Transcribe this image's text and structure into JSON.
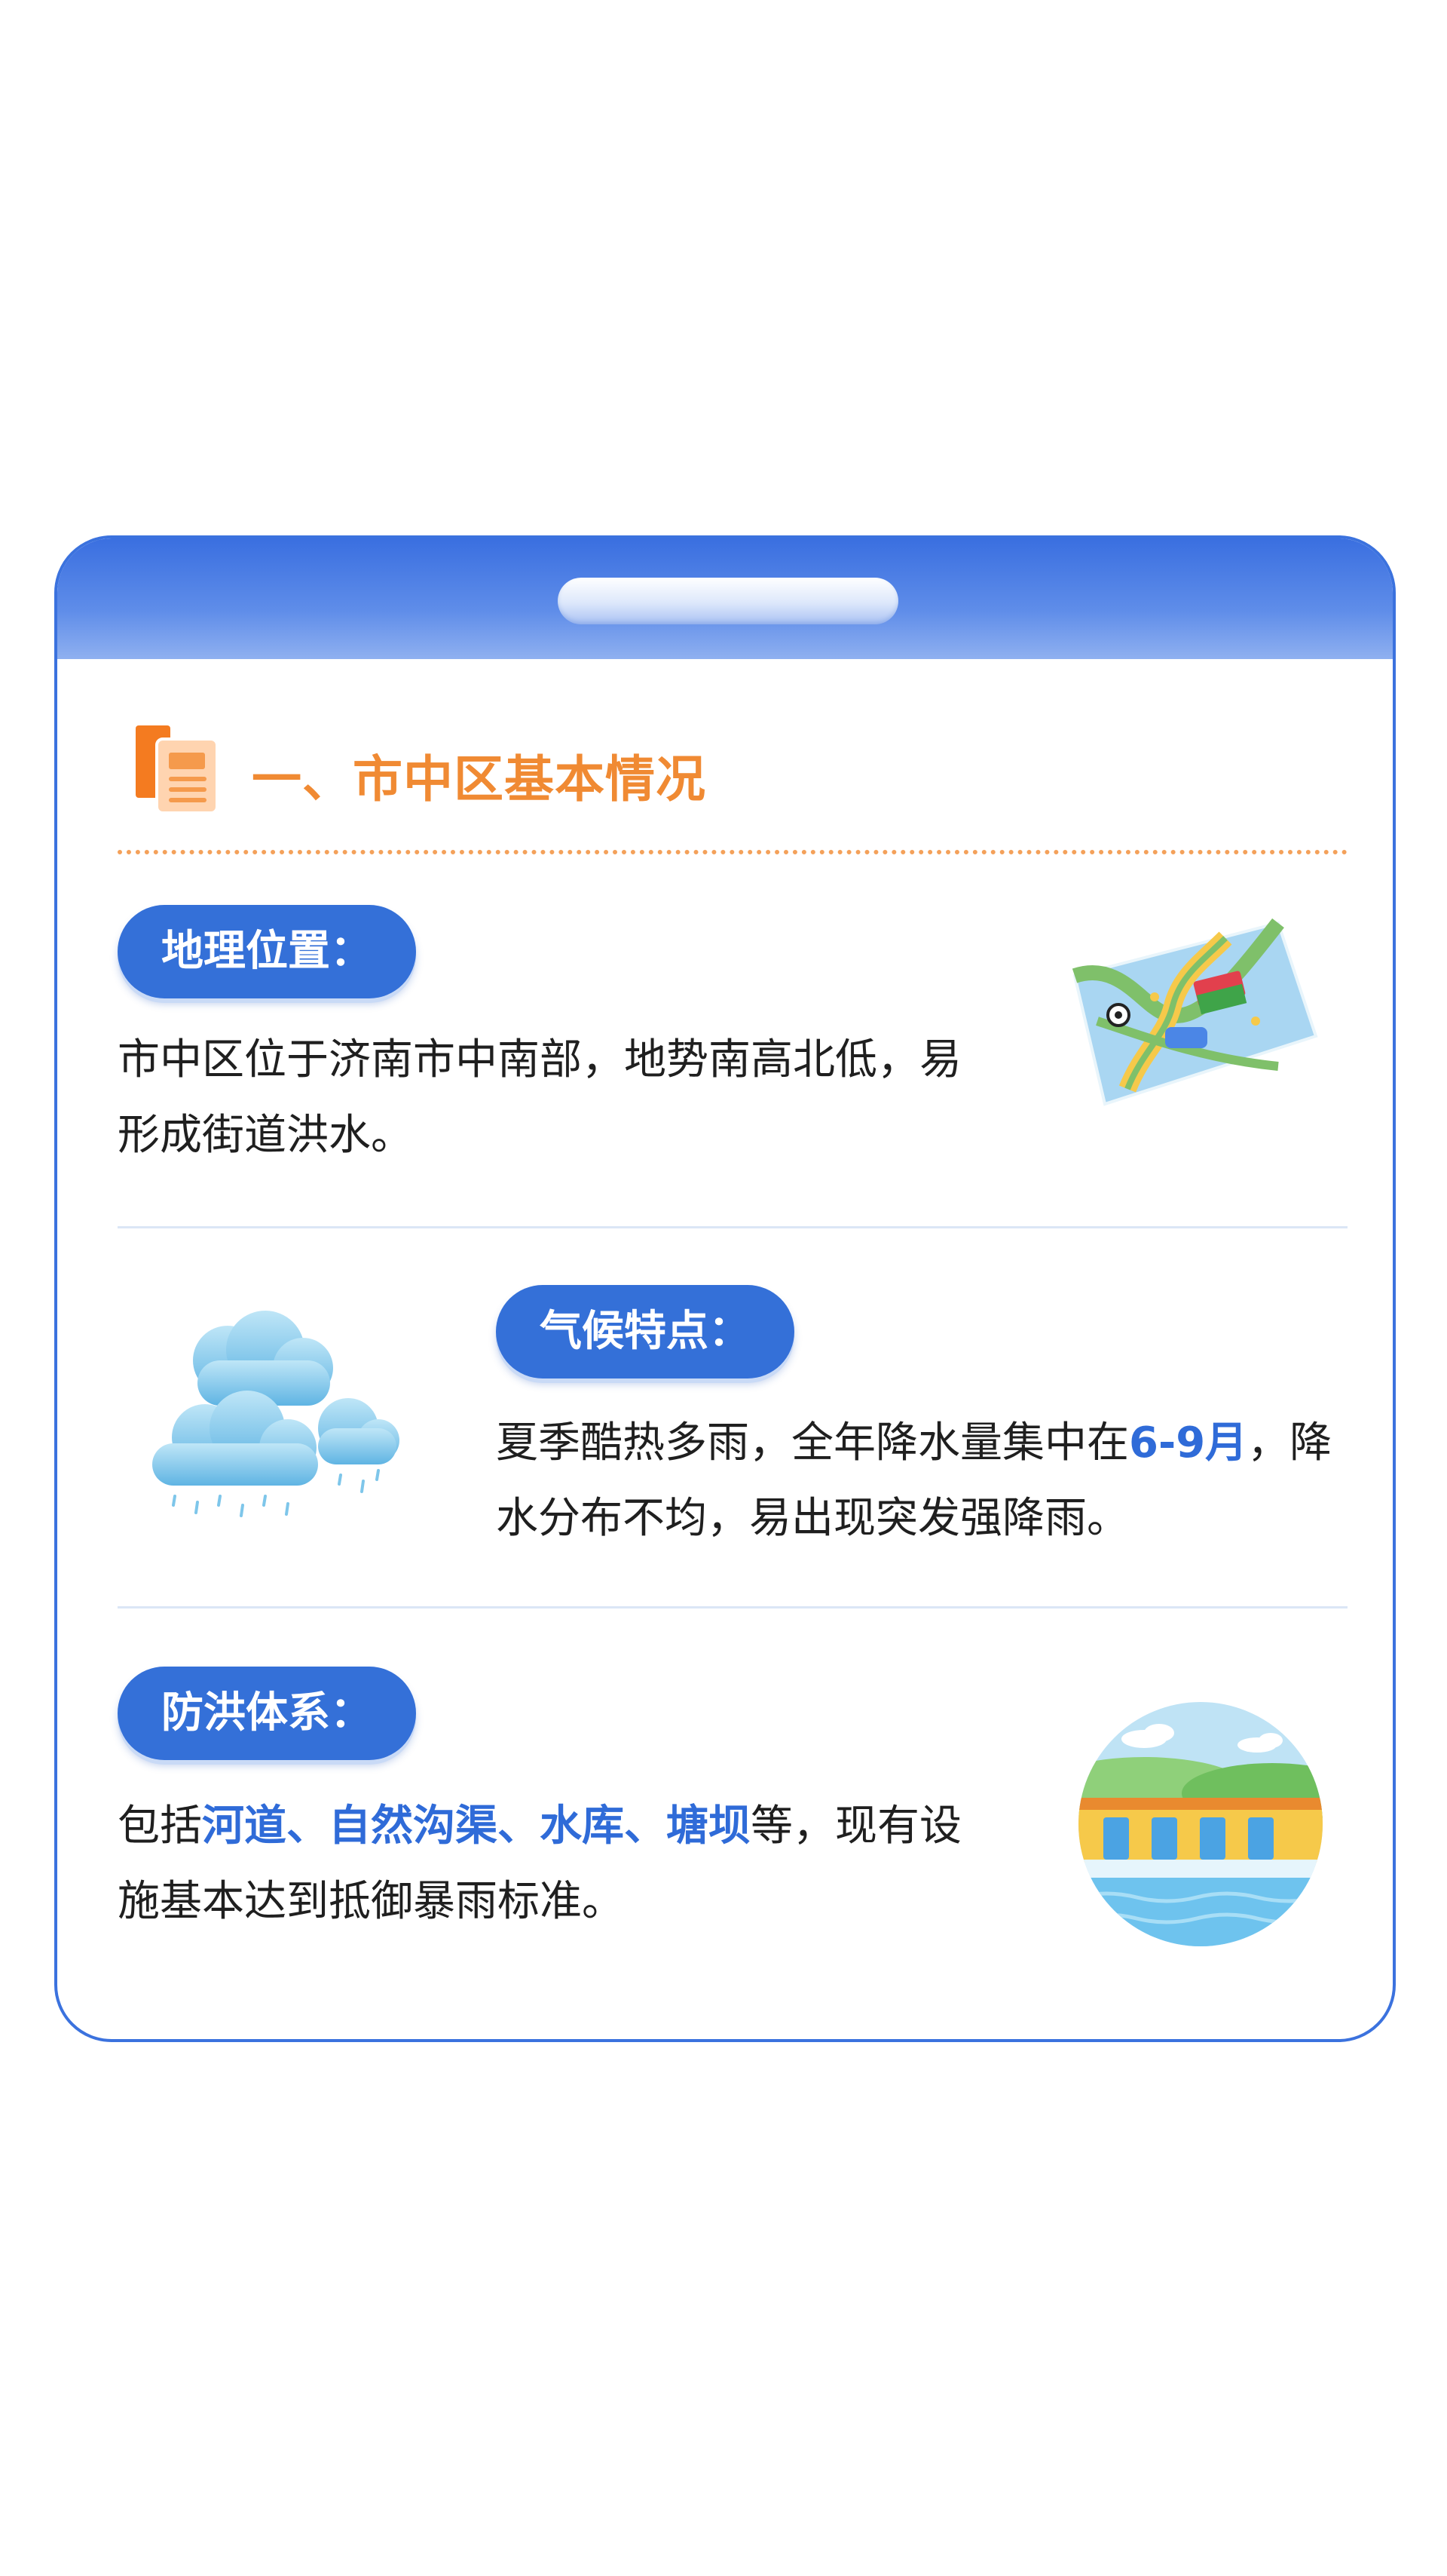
{
  "section": {
    "title": "一、市中区基本情况"
  },
  "items": [
    {
      "label": "地理位置：",
      "text_lines": [
        "市中区位于济南市中南部，地势南高北低，易",
        "形成街道洪水。"
      ],
      "icon": "map-icon"
    },
    {
      "label": "气候特点：",
      "line1_pre": "夏季酷热多雨，全年降水量集中在",
      "line1_hl": "6-9月",
      "line1_post": "，降",
      "line2": "水分布不均，易出现突发强降雨。",
      "icon": "rain-cloud-icon"
    },
    {
      "label": "防洪体系：",
      "line1_pre": "包括",
      "line1_hl": "河道、自然沟渠、水库、塘坝",
      "line1_post": "等，现有设",
      "line2": "施基本达到抵御暴雨标准。",
      "icon": "dam-icon"
    }
  ],
  "colors": {
    "primary_blue": "#3470d8",
    "accent_orange": "#f08a33",
    "highlight_blue": "#2f6bd8"
  }
}
